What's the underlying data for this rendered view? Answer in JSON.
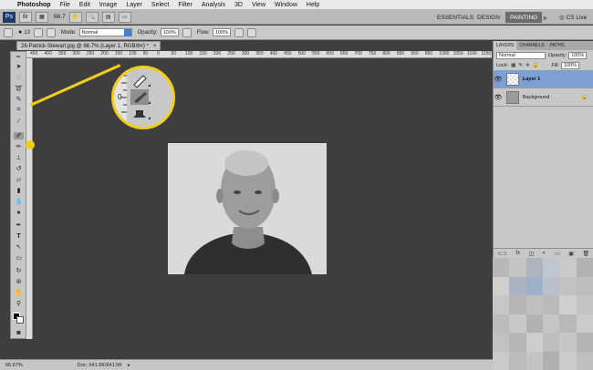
{
  "menubar": {
    "app_name": "Photoshop",
    "items": [
      "File",
      "Edit",
      "Image",
      "Layer",
      "Select",
      "Filter",
      "Analysis",
      "3D",
      "View",
      "Window",
      "Help"
    ]
  },
  "appbar": {
    "logo": "Ps",
    "zoom": "66.7",
    "workspaces": [
      "ESSENTIALS",
      "DESIGN",
      "PAINTING"
    ],
    "active_workspace": "PAINTING",
    "overflow": "»",
    "cs_live": "CS Live"
  },
  "options": {
    "brush_size": "13",
    "mode_label": "Mode:",
    "mode_value": "Normal",
    "opacity_label": "Opacity:",
    "opacity_value": "100%",
    "flow_label": "Flow:",
    "flow_value": "100%"
  },
  "document": {
    "tab_title": "26-Patrick-Stewart.jpg @ 66.7% (Layer 1, RGB/8#) *"
  },
  "ruler": {
    "ticks": [
      "450",
      "400",
      "350",
      "300",
      "250",
      "200",
      "150",
      "100",
      "50",
      "0",
      "50",
      "100",
      "150",
      "200",
      "250",
      "300",
      "350",
      "400",
      "450",
      "500",
      "550",
      "600",
      "650",
      "700",
      "750",
      "800",
      "850",
      "900",
      "950",
      "1000",
      "1050",
      "1100",
      "1150"
    ]
  },
  "status": {
    "zoom": "66.67%",
    "doc": "Doc: 641.6K/641.5K"
  },
  "layers_panel": {
    "tabs": [
      "LAYERS",
      "CHANNELS",
      "PATHS"
    ],
    "blend_mode": "Normal",
    "opacity_label": "Opacity:",
    "opacity_value": "100%",
    "lock_label": "Lock:",
    "fill_label": "Fill:",
    "fill_value": "100%",
    "layers": [
      {
        "name": "Layer 1",
        "selected": true
      },
      {
        "name": "Background",
        "selected": false
      }
    ],
    "footer_icons": [
      "link-icon",
      "fx-icon",
      "mask-icon",
      "adjustment-icon",
      "group-icon",
      "new-layer-icon",
      "trash-icon"
    ]
  },
  "colors": {
    "callout": "#f2cd1a",
    "selection": "#7d9fd1",
    "canvas_bg": "#3e3e3e"
  }
}
